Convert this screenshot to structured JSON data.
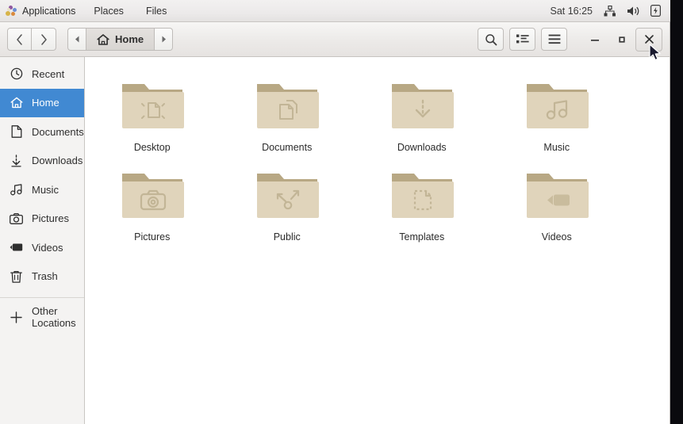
{
  "topbar": {
    "activities_icon": "gnome-paw-icon",
    "menus": [
      {
        "label": "Applications",
        "name": "topbar-menu-applications"
      },
      {
        "label": "Places",
        "name": "topbar-menu-places"
      },
      {
        "label": "Files",
        "name": "topbar-menu-files"
      }
    ],
    "clock": "Sat 16:25",
    "status_icons": [
      "network-icon",
      "volume-icon",
      "battery-icon"
    ]
  },
  "headerbar": {
    "back_icon": "chevron-left-icon",
    "forward_icon": "chevron-right-icon",
    "breadcrumb_prev_icon": "triangle-left-icon",
    "breadcrumb_next_icon": "triangle-right-icon",
    "breadcrumb_home_icon": "home-icon",
    "breadcrumb_label": "Home",
    "search_icon": "search-icon",
    "view_list_icon": "list-view-icon",
    "menu_icon": "hamburger-menu-icon",
    "minimize_label": "–",
    "maximize_label": "□",
    "close_label": "✕"
  },
  "sidebar": {
    "items": [
      {
        "label": "Recent",
        "icon": "clock-icon",
        "selected": false
      },
      {
        "label": "Home",
        "icon": "home-icon",
        "selected": true
      },
      {
        "label": "Documents",
        "icon": "document-icon",
        "selected": false
      },
      {
        "label": "Downloads",
        "icon": "download-icon",
        "selected": false
      },
      {
        "label": "Music",
        "icon": "music-note-icon",
        "selected": false
      },
      {
        "label": "Pictures",
        "icon": "camera-icon",
        "selected": false
      },
      {
        "label": "Videos",
        "icon": "film-icon",
        "selected": false
      },
      {
        "label": "Trash",
        "icon": "trash-icon",
        "selected": false
      }
    ],
    "other_locations": {
      "label": "Other Locations",
      "icon": "plus-icon"
    }
  },
  "content": {
    "folders": [
      {
        "label": "Desktop",
        "emblem": "desktop-emblem"
      },
      {
        "label": "Documents",
        "emblem": "documents-emblem"
      },
      {
        "label": "Downloads",
        "emblem": "download-emblem"
      },
      {
        "label": "Music",
        "emblem": "music-emblem"
      },
      {
        "label": "Pictures",
        "emblem": "camera-emblem"
      },
      {
        "label": "Public",
        "emblem": "share-emblem"
      },
      {
        "label": "Templates",
        "emblem": "template-emblem"
      },
      {
        "label": "Videos",
        "emblem": "video-camera-emblem"
      }
    ]
  },
  "colors": {
    "accent": "#4189d2",
    "folder_body": "#e0d4bb",
    "folder_back": "#b8a884",
    "panel": "#f2f1f0",
    "sidebar": "#f4f3f2"
  }
}
